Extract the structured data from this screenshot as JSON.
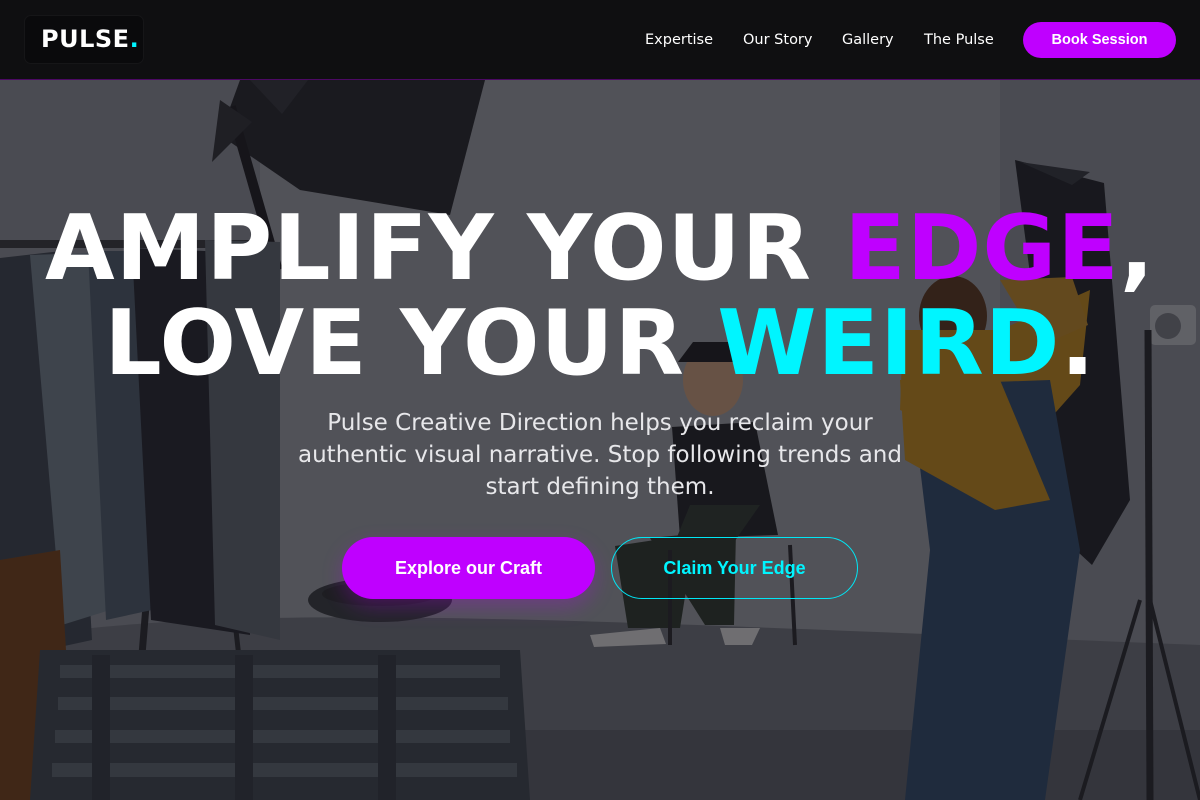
{
  "header": {
    "logo": {
      "text": "PULSE",
      "accent": "."
    },
    "nav": [
      {
        "label": "Expertise"
      },
      {
        "label": "Our Story"
      },
      {
        "label": "Gallery"
      },
      {
        "label": "The Pulse"
      }
    ],
    "cta": "Book Session"
  },
  "hero": {
    "headline": {
      "line1_prefix": "AMPLIFY YOUR ",
      "line1_highlight": "EDGE",
      "line1_suffix": ",",
      "line2_prefix": "LOVE YOUR ",
      "line2_highlight": "WEIRD",
      "line2_suffix": "."
    },
    "subtext": "Pulse Creative Direction helps you reclaim your authentic visual narrative. Stop following trends and start defining them.",
    "primary_button": "Explore our Craft",
    "secondary_button": "Claim Your Edge"
  },
  "colors": {
    "accent_purple": "#bf00ff",
    "accent_cyan": "#00f5ff",
    "header_bg": "#100f12",
    "text_white": "#ffffff"
  }
}
